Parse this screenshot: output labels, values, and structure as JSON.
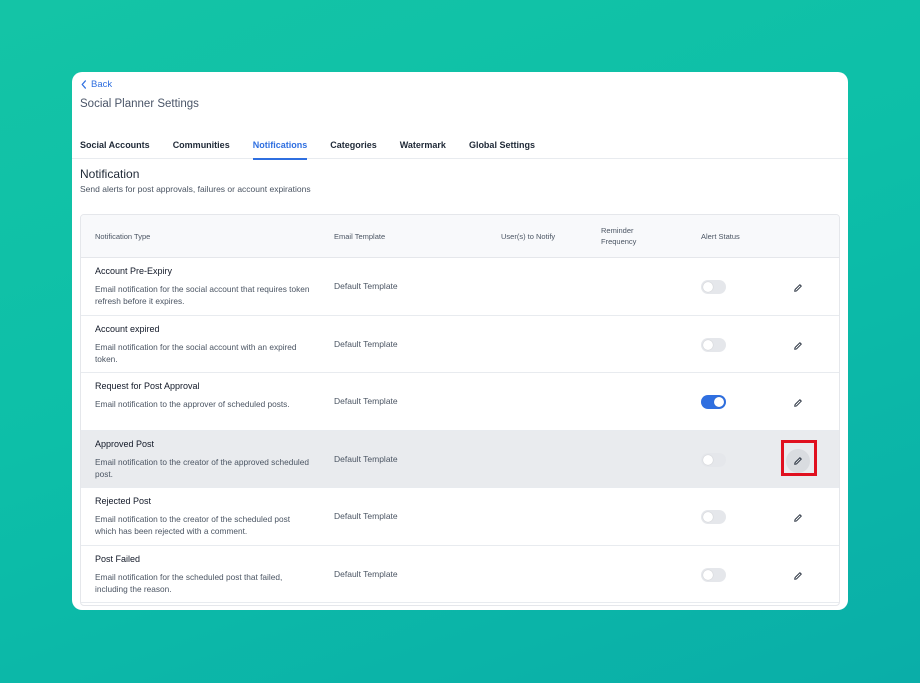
{
  "header": {
    "back_label": "Back",
    "title": "Social Planner Settings"
  },
  "tabs": [
    {
      "label": "Social Accounts",
      "active": false
    },
    {
      "label": "Communities",
      "active": false
    },
    {
      "label": "Notifications",
      "active": true
    },
    {
      "label": "Categories",
      "active": false
    },
    {
      "label": "Watermark",
      "active": false
    },
    {
      "label": "Global Settings",
      "active": false
    }
  ],
  "section": {
    "title": "Notification",
    "subtitle": "Send alerts for post approvals, failures or account expirations"
  },
  "table": {
    "headers": {
      "type": "Notification Type",
      "template": "Email Template",
      "users": "User(s) to Notify",
      "reminder_line1": "Reminder",
      "reminder_line2": "Frequency",
      "status": "Alert Status"
    },
    "rows": [
      {
        "title": "Account Pre-Expiry",
        "description": "Email notification for the social account that requires token refresh before it expires.",
        "template": "Default Template",
        "enabled": false
      },
      {
        "title": "Account expired",
        "description": "Email notification for the social account with an expired token.",
        "template": "Default Template",
        "enabled": false
      },
      {
        "title": "Request for Post Approval",
        "description": "Email notification to the approver of scheduled posts.",
        "template": "Default Template",
        "enabled": true
      },
      {
        "title": "Approved Post",
        "description": "Email notification to the creator of the approved scheduled post.",
        "template": "Default Template",
        "enabled": false,
        "highlighted": true
      },
      {
        "title": "Rejected Post",
        "description": "Email notification to the creator of the scheduled post which has been rejected with a comment.",
        "template": "Default Template",
        "enabled": false
      },
      {
        "title": "Post Failed",
        "description": "Email notification for the scheduled post that failed, including the reason.",
        "template": "Default Template",
        "enabled": false
      }
    ]
  },
  "colors": {
    "accent": "#2f6fe0",
    "highlight_box": "#e0101f",
    "background": "#14c4a6"
  },
  "icons": {
    "back": "chevron-left-icon",
    "edit": "pencil-icon"
  }
}
